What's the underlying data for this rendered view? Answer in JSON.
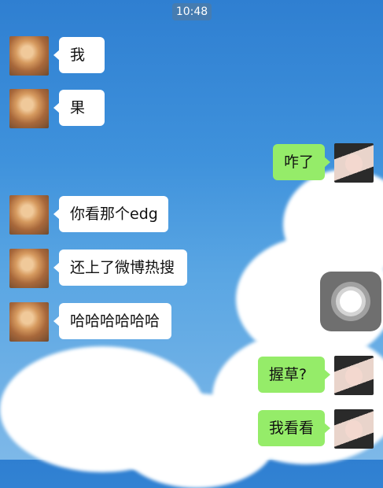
{
  "status_time": "10:48",
  "messages": [
    {
      "side": "left",
      "text": "我"
    },
    {
      "side": "left",
      "text": "果"
    },
    {
      "side": "right",
      "text": "咋了"
    },
    {
      "side": "left",
      "text": "你看那个edg"
    },
    {
      "side": "left",
      "text": "还上了微博热搜"
    },
    {
      "side": "left",
      "text": "哈哈哈哈哈哈"
    },
    {
      "side": "right",
      "text": "握草?"
    },
    {
      "side": "right",
      "text": "我看看"
    }
  ]
}
